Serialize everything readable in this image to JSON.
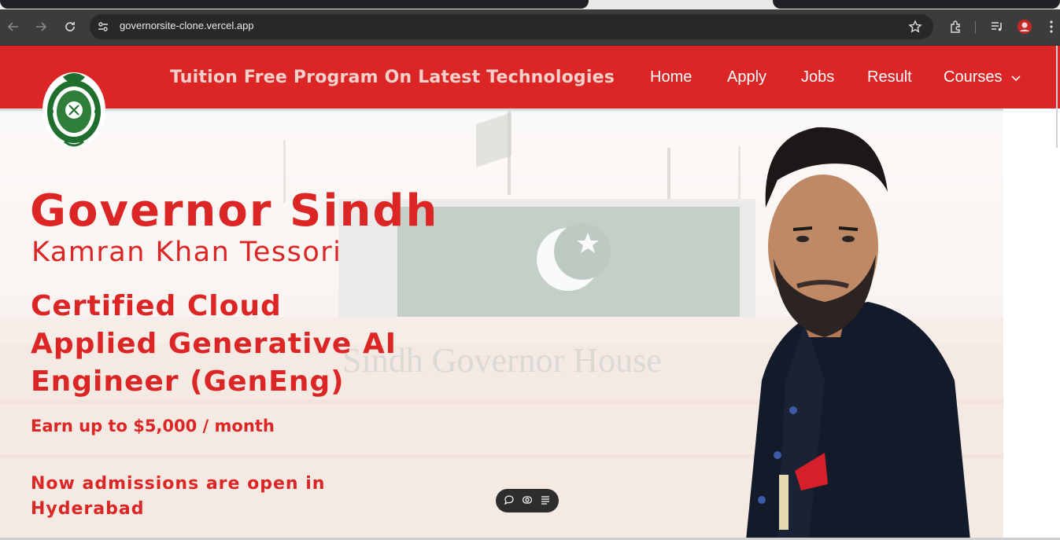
{
  "browser": {
    "url": "governorsite-clone.vercel.app",
    "icons": [
      "back-icon",
      "forward-icon",
      "reload-icon",
      "site-settings-icon",
      "bookmark-star-icon",
      "extensions-icon",
      "media-controls-icon",
      "profile-icon",
      "menu-icon"
    ]
  },
  "nav": {
    "tagline": "Tuition Free Program On Latest Technologies",
    "items": [
      "Home",
      "Apply",
      "Jobs",
      "Result",
      "Courses"
    ]
  },
  "hero": {
    "title": "Governor Sindh",
    "name": "Kamran Khan Tessori",
    "program_lines": [
      "Certified Cloud",
      "Applied Generative AI",
      "Engineer (GenEng)"
    ],
    "earn": "Earn up to $5,000 / month",
    "admission_lines": [
      "Now admissions are open in",
      "Hyderabad"
    ],
    "background_sign": "Sindh Governor House"
  },
  "floating_toolbar": {
    "icons": [
      "comment-icon",
      "eye-icon",
      "list-icon"
    ]
  },
  "colors": {
    "brand_red": "#dc2626",
    "chrome_dark": "#3c3c3c"
  }
}
